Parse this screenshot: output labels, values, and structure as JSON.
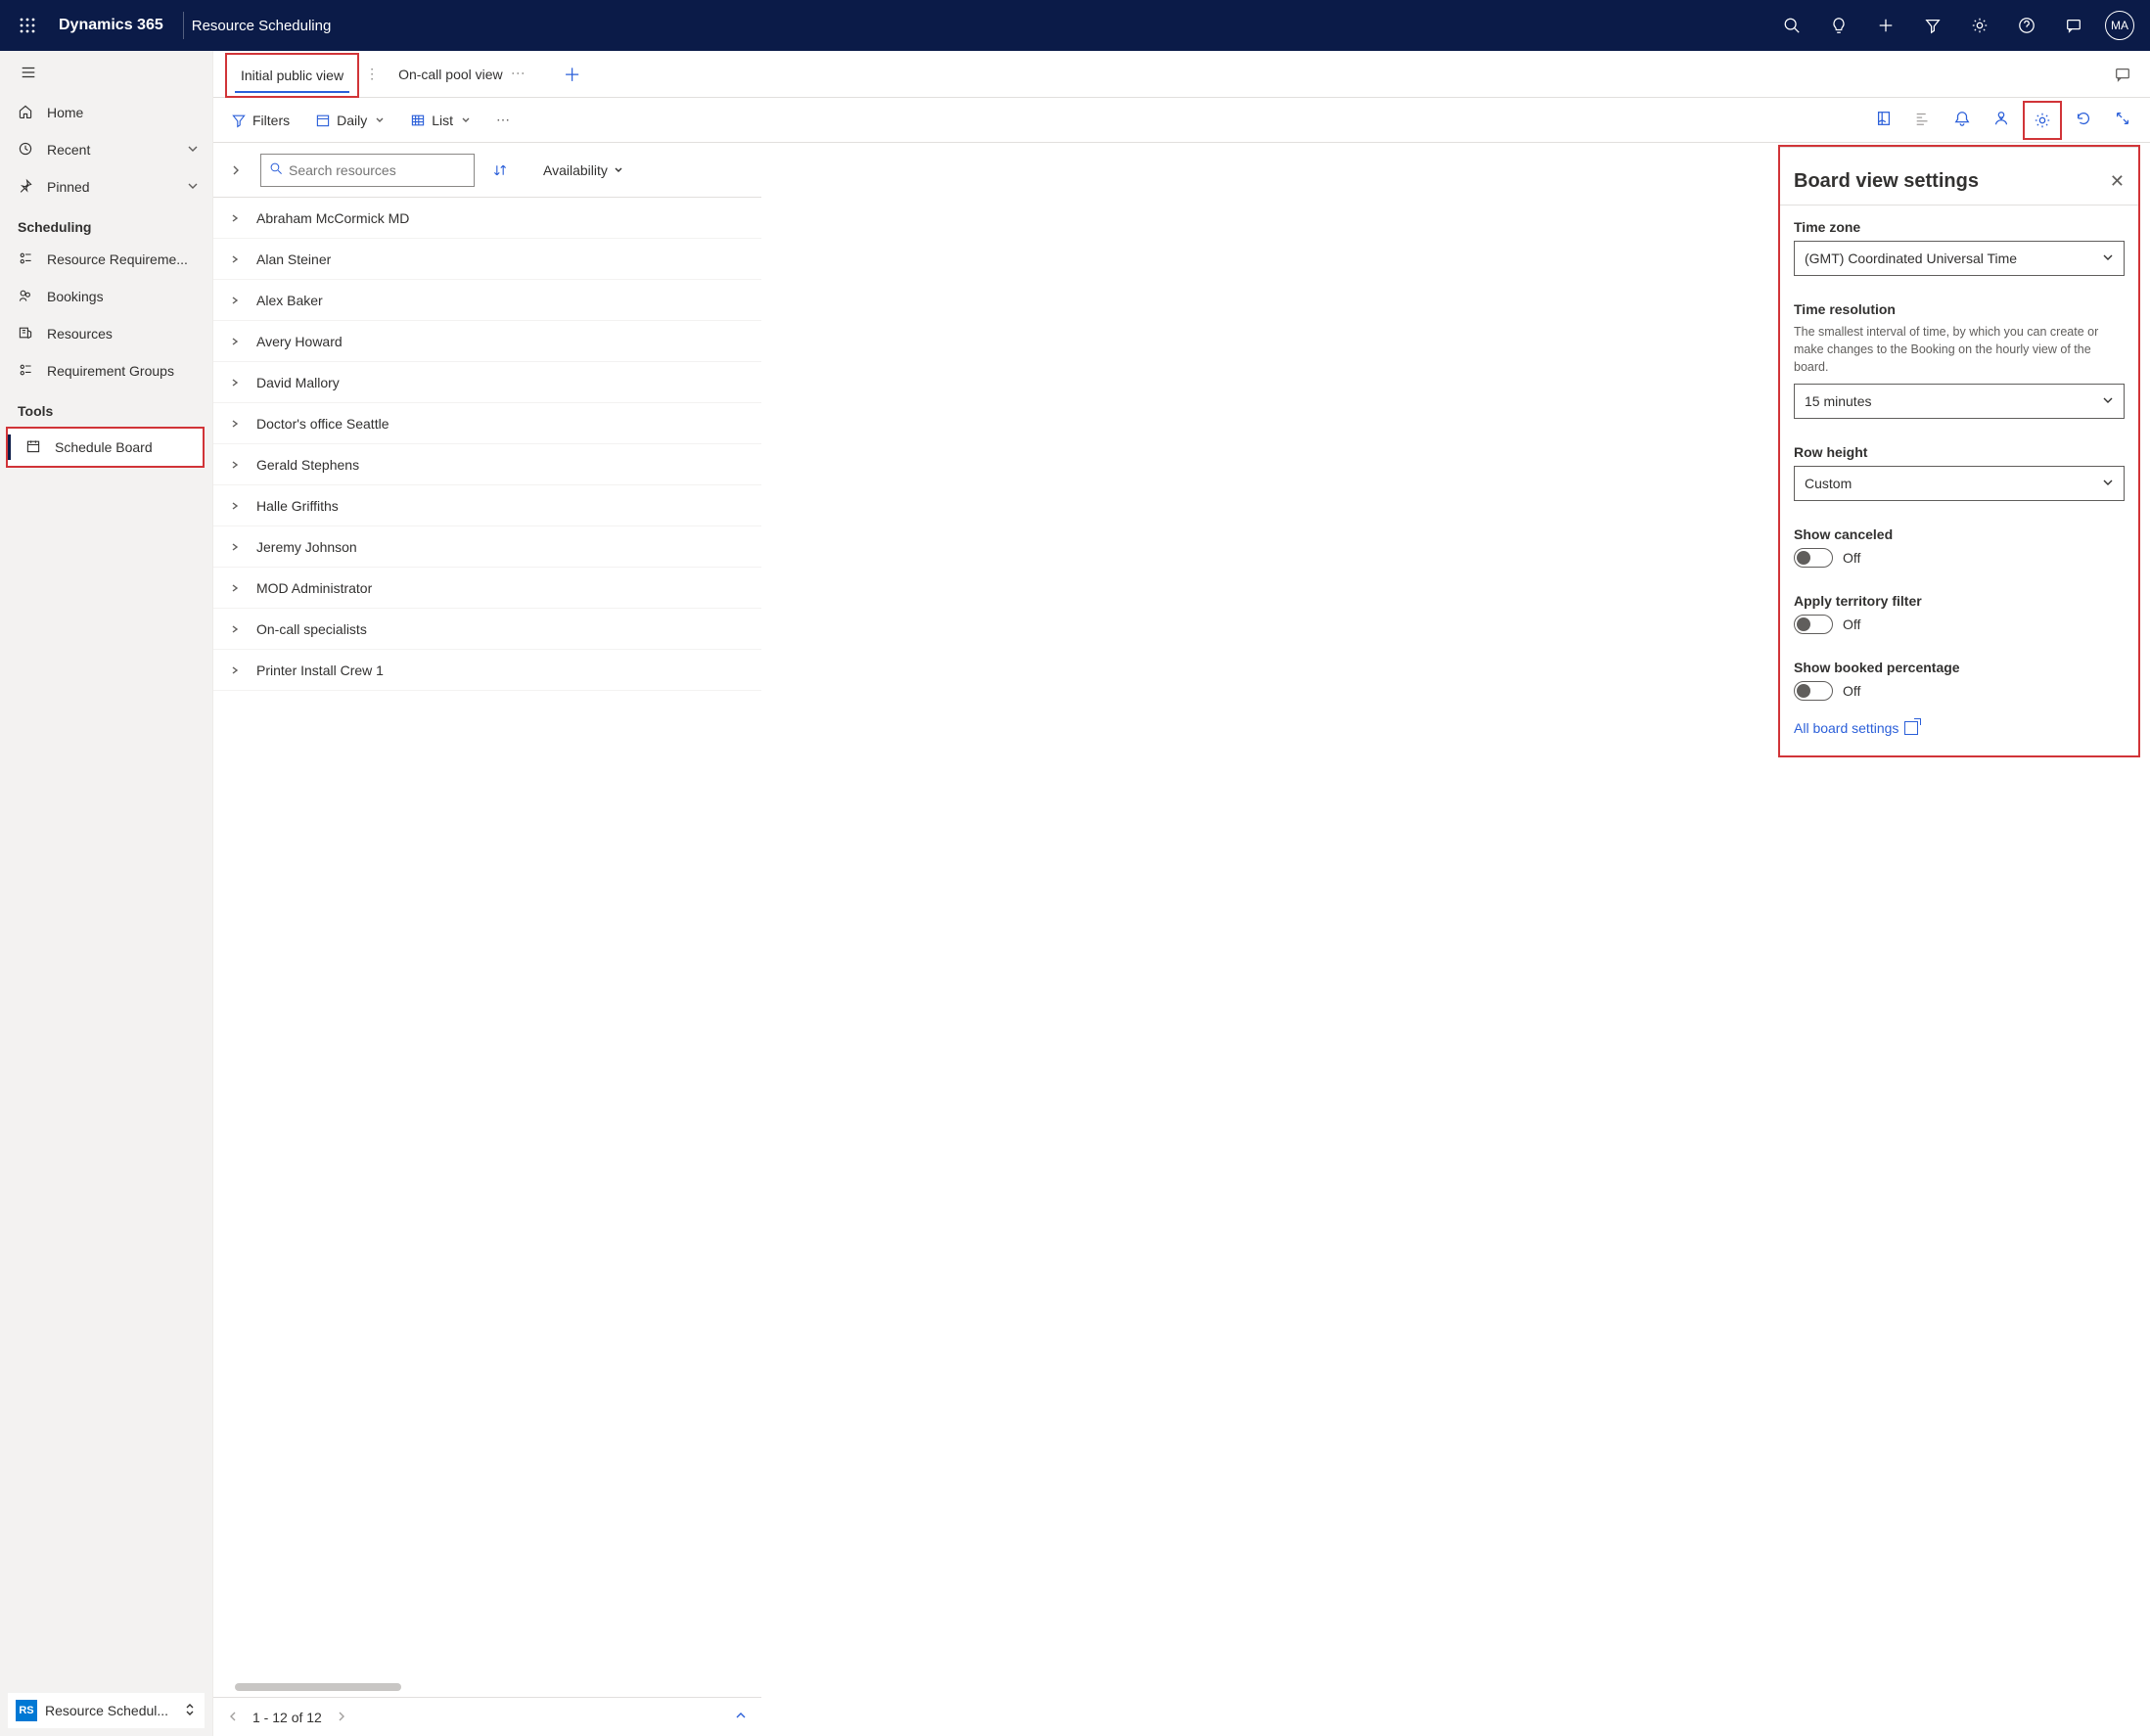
{
  "header": {
    "brand": "Dynamics 365",
    "app_name": "Resource Scheduling",
    "avatar_initials": "MA"
  },
  "sidebar": {
    "items": [
      {
        "icon": "home",
        "label": "Home"
      },
      {
        "icon": "clock",
        "label": "Recent",
        "expandable": true
      },
      {
        "icon": "pin",
        "label": "Pinned",
        "expandable": true
      }
    ],
    "section1": "Scheduling",
    "section1_items": [
      {
        "icon": "req",
        "label": "Resource Requireme..."
      },
      {
        "icon": "bookings",
        "label": "Bookings"
      },
      {
        "icon": "resources",
        "label": "Resources"
      },
      {
        "icon": "groups",
        "label": "Requirement Groups"
      }
    ],
    "section2": "Tools",
    "section2_items": [
      {
        "icon": "calendar",
        "label": "Schedule Board",
        "active": true
      }
    ],
    "footer": {
      "badge": "RS",
      "label": "Resource Schedul..."
    }
  },
  "tabs": [
    {
      "label": "Initial public view",
      "active": true
    },
    {
      "label": "On-call pool view"
    }
  ],
  "toolbar": {
    "filters": "Filters",
    "daily": "Daily",
    "list": "List"
  },
  "resource_col": {
    "search_placeholder": "Search resources",
    "availability": "Availability",
    "rows": [
      "Abraham McCormick MD",
      "Alan Steiner",
      "Alex Baker",
      "Avery Howard",
      "David Mallory",
      "Doctor's office Seattle",
      "Gerald Stephens",
      "Halle Griffiths",
      "Jeremy Johnson",
      "MOD Administrator",
      "On-call specialists",
      "Printer Install Crew 1"
    ],
    "pager": "1 - 12 of 12"
  },
  "panel": {
    "title": "Board view settings",
    "tz_label": "Time zone",
    "tz_value": "(GMT) Coordinated Universal Time",
    "res_label": "Time resolution",
    "res_desc": "The smallest interval of time, by which you can create or make changes to the Booking on the hourly view of the board.",
    "res_value": "15 minutes",
    "row_label": "Row height",
    "row_value": "Custom",
    "show_canceled_label": "Show canceled",
    "off": "Off",
    "territory_label": "Apply territory filter",
    "booked_label": "Show booked percentage",
    "all_settings": "All board settings"
  }
}
